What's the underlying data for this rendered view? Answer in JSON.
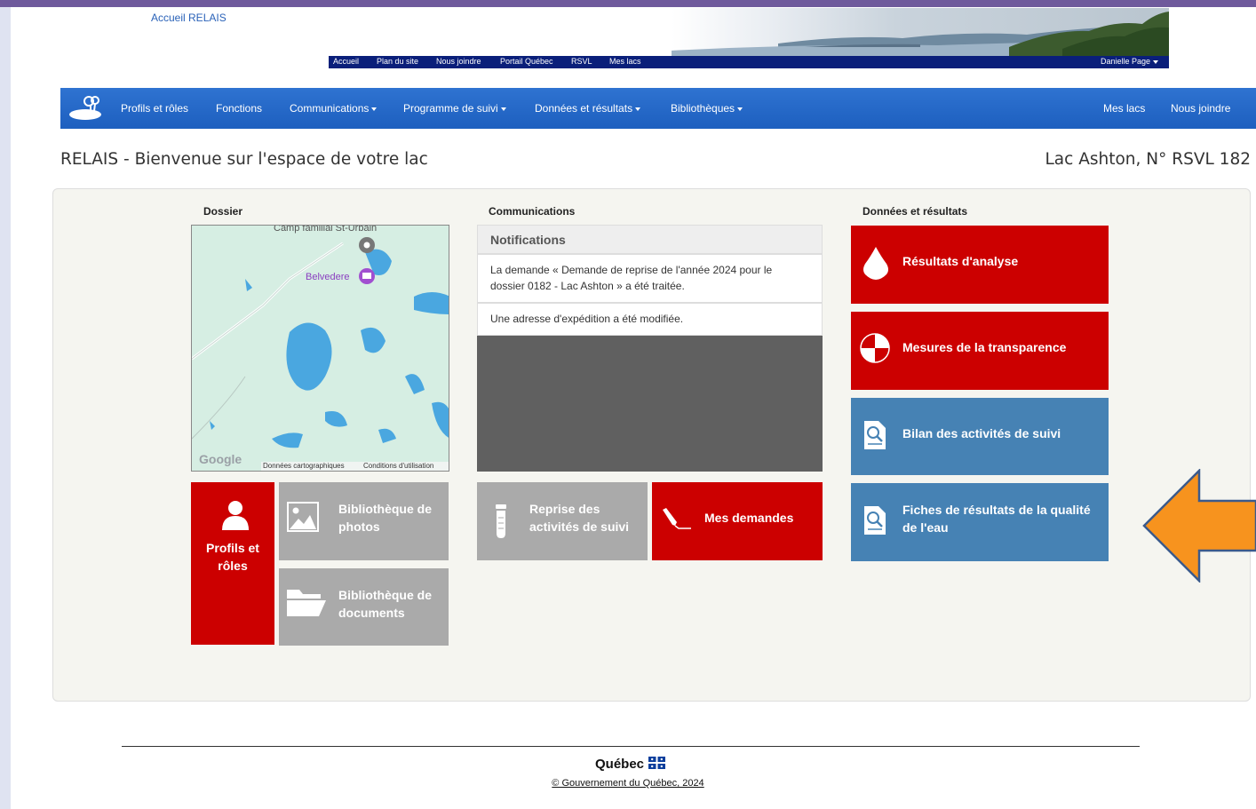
{
  "header": {
    "home_link": "Accueil RELAIS",
    "top_links": [
      "Accueil",
      "Plan du site",
      "Nous joindre",
      "Portail Québec",
      "RSVL",
      "Mes lacs"
    ],
    "user_name": "Danielle Page"
  },
  "navbar": {
    "items": [
      {
        "label": "Profils et rôles",
        "dropdown": false
      },
      {
        "label": "Fonctions",
        "dropdown": false
      },
      {
        "label": "Communications",
        "dropdown": true
      },
      {
        "label": "Programme de suivi",
        "dropdown": true
      },
      {
        "label": "Données et résultats",
        "dropdown": true
      },
      {
        "label": "Bibliothèques",
        "dropdown": true
      }
    ],
    "right_items": [
      "Mes lacs",
      "Nous joindre"
    ]
  },
  "page": {
    "title": "RELAIS - Bienvenue sur l'espace de votre lac",
    "lake": "Lac Ashton, N° RSVL 182"
  },
  "dossier": {
    "heading": "Dossier",
    "map": {
      "place_top": "Camp familial St-Urbain",
      "place_belvedere": "Belvedere",
      "logo": "Google",
      "attribution": "Données cartographiques",
      "terms": "Conditions d'utilisation"
    },
    "tiles": {
      "profils": "Profils et rôles",
      "photos": "Bibliothèque de photos",
      "documents": "Bibliothèque de documents"
    }
  },
  "communications": {
    "heading": "Communications",
    "notifications_title": "Notifications",
    "notifications": [
      "La demande « Demande de reprise de l'année 2024 pour le dossier 0182 - Lac Ashton » a été traitée.",
      "Une adresse d'expédition a été modifiée."
    ],
    "tiles": {
      "reprise": "Reprise des activités de suivi",
      "demandes": "Mes demandes"
    }
  },
  "resultats": {
    "heading": "Données et résultats",
    "tiles": [
      "Résultats d'analyse",
      "Mesures de la transparence",
      "Bilan des activités de suivi",
      "Fiches de résultats de la qualité de l'eau"
    ]
  },
  "footer": {
    "logo": "Québec",
    "copyright": "© Gouvernement du Québec, 2024"
  },
  "colors": {
    "red_tile": "#cc0000",
    "blue_tile": "#4682b4",
    "gray_tile": "#aaaaaa",
    "navbar": "#2369c8",
    "arrow": "#f7931e"
  },
  "icons": [
    "water-drop-icon",
    "secchi-disk-icon",
    "document-search-icon",
    "user-icon",
    "image-icon",
    "folder-icon",
    "test-tube-icon",
    "pen-icon",
    "lake-logo-icon"
  ]
}
